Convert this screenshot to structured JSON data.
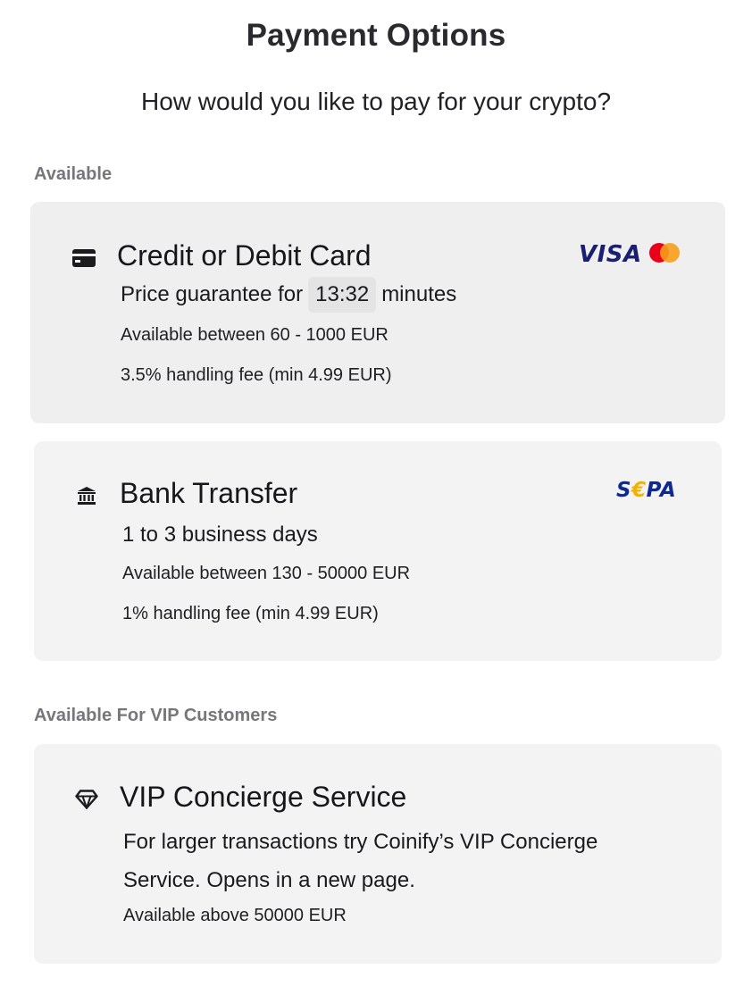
{
  "header": {
    "title": "Payment Options",
    "subtitle": "How would you like to pay for your crypto?"
  },
  "sections": {
    "available_label": "Available",
    "vip_label": "Available For VIP Customers"
  },
  "credit_card": {
    "icon": "credit-card-icon",
    "title": "Credit or Debit Card",
    "guarantee_prefix": "Price guarantee for",
    "timer": "13:32",
    "guarantee_suffix": "minutes",
    "range": "Available between 60 - 1000 EUR",
    "fee": "3.5% handling fee (min 4.99 EUR)",
    "logos": {
      "visa": "VISA",
      "mastercard": "mastercard-logo"
    }
  },
  "bank_transfer": {
    "icon": "bank-icon",
    "title": "Bank Transfer",
    "duration": "1 to 3 business days",
    "range": "Available between 130 - 50000 EUR",
    "fee": "1% handling fee (min 4.99 EUR)",
    "logo": {
      "s": "S",
      "euro": "€",
      "pa": "PA"
    }
  },
  "vip": {
    "icon": "diamond-icon",
    "title": "VIP Concierge Service",
    "description": "For larger transactions try Coinify’s VIP Concierge Service. Opens in a new page.",
    "range": "Available above 50000 EUR"
  },
  "colors": {
    "card_bg": "#f3f3f3",
    "label_gray": "#76767c",
    "visa_blue": "#1a1f71",
    "sepa_blue": "#10298e",
    "sepa_gold": "#f0b400"
  }
}
